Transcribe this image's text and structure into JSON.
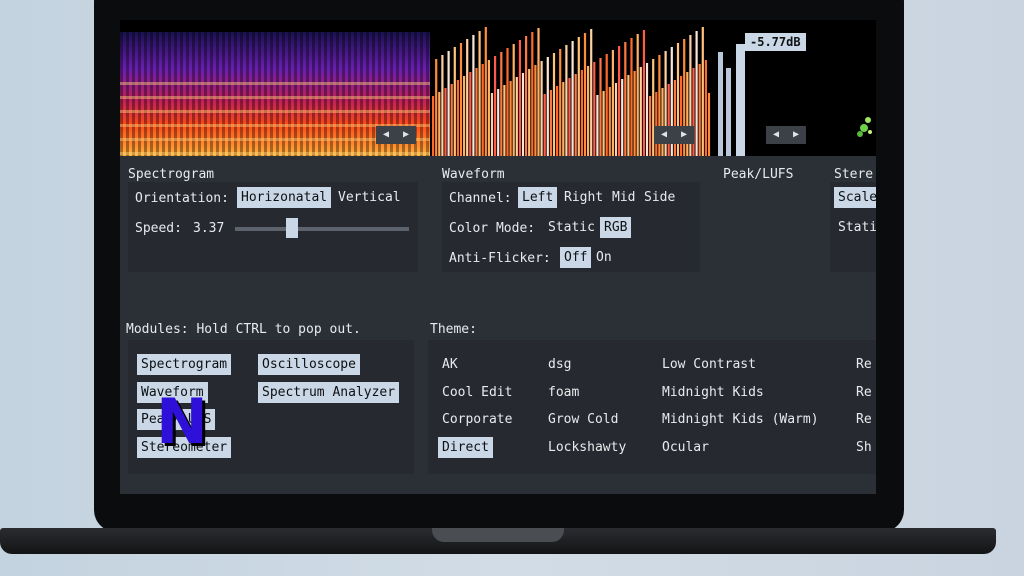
{
  "visualizer": {
    "peak_readout": "-5.77dB",
    "nav_prev": "◀",
    "nav_next": "▶"
  },
  "spectrogram_section": {
    "title": "Spectrogram",
    "orientation_label": "Orientation:",
    "orientation_options": [
      "Horizonatal",
      "Vertical"
    ],
    "orientation_selected": "Horizonatal",
    "speed_label": "Speed:",
    "speed_value": "3.37",
    "speed_level": 0.33
  },
  "waveform_section": {
    "title": "Waveform",
    "channel_label": "Channel:",
    "channel_options": [
      "Left",
      "Right",
      "Mid",
      "Side"
    ],
    "channel_selected": "Left",
    "color_mode_label": "Color Mode:",
    "color_mode_options": [
      "Static",
      "RGB"
    ],
    "color_mode_selected": "RGB",
    "anti_flicker_label": "Anti-Flicker:",
    "anti_flicker_options": [
      "Off",
      "On"
    ],
    "anti_flicker_selected": "Off"
  },
  "peak_section": {
    "title": "Peak/LUFS"
  },
  "stereo_section": {
    "title": "Stere",
    "option_a": "Scale",
    "option_b": "Stati"
  },
  "modules_section": {
    "title": "Modules: Hold CTRL to pop out.",
    "left_column": [
      "Spectrogram",
      "Waveform",
      "Peak/LUFS",
      "Stereometer"
    ],
    "right_column": [
      "Oscilloscope",
      "Spectrum Analyzer"
    ]
  },
  "theme_section": {
    "title": "Theme:",
    "col1": [
      "AK",
      "Cool Edit",
      "Corporate",
      "Direct"
    ],
    "col2": [
      "dsg",
      "foam",
      "Grow Cold",
      "Lockshawty"
    ],
    "col3": [
      "Low Contrast",
      "Midnight Kids",
      "Midnight Kids (Warm)",
      "Ocular"
    ],
    "col4": [
      "Re",
      "Re",
      "Re",
      "Sh"
    ],
    "selected": "Direct"
  },
  "overlay_logo": {
    "letter": "N",
    "color": "#2f10d8"
  },
  "colors": {
    "accent": "#c9d7e6",
    "panel_bg": "#262a30",
    "screen_bg": "#2b3036"
  }
}
